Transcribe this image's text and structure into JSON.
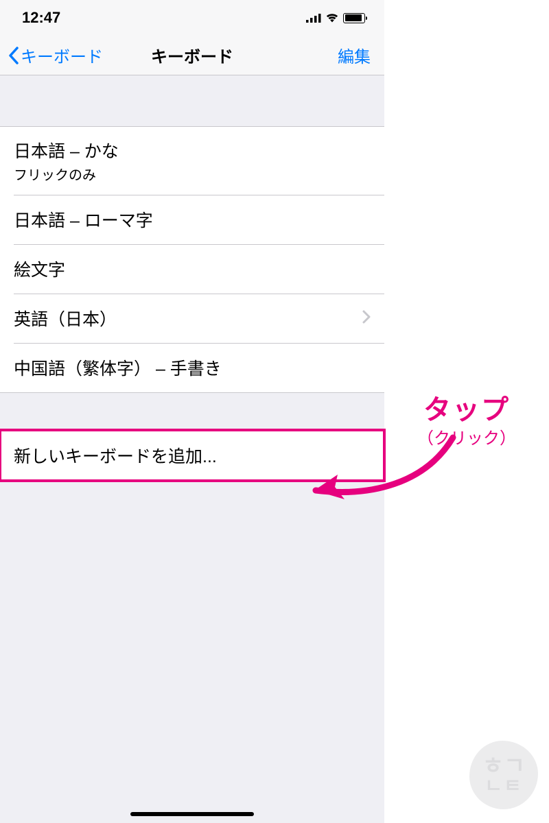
{
  "status": {
    "time": "12:47"
  },
  "nav": {
    "back_label": "キーボード",
    "title": "キーボード",
    "edit_label": "編集"
  },
  "keyboards": [
    {
      "title": "日本語 – かな",
      "subtitle": "フリックのみ",
      "disclosure": false
    },
    {
      "title": "日本語 – ローマ字",
      "subtitle": "",
      "disclosure": false
    },
    {
      "title": "絵文字",
      "subtitle": "",
      "disclosure": false
    },
    {
      "title": "英語（日本）",
      "subtitle": "",
      "disclosure": true
    },
    {
      "title": "中国語（繁体字） – 手書き",
      "subtitle": "",
      "disclosure": false
    }
  ],
  "add_keyboard": {
    "label": "新しいキーボードを追加..."
  },
  "annotation": {
    "title": "タップ",
    "subtitle": "（クリック）",
    "color": "#e6007e"
  },
  "watermark": {
    "top": "ㅎㄱ",
    "bottom": "ㄴㅌ"
  }
}
